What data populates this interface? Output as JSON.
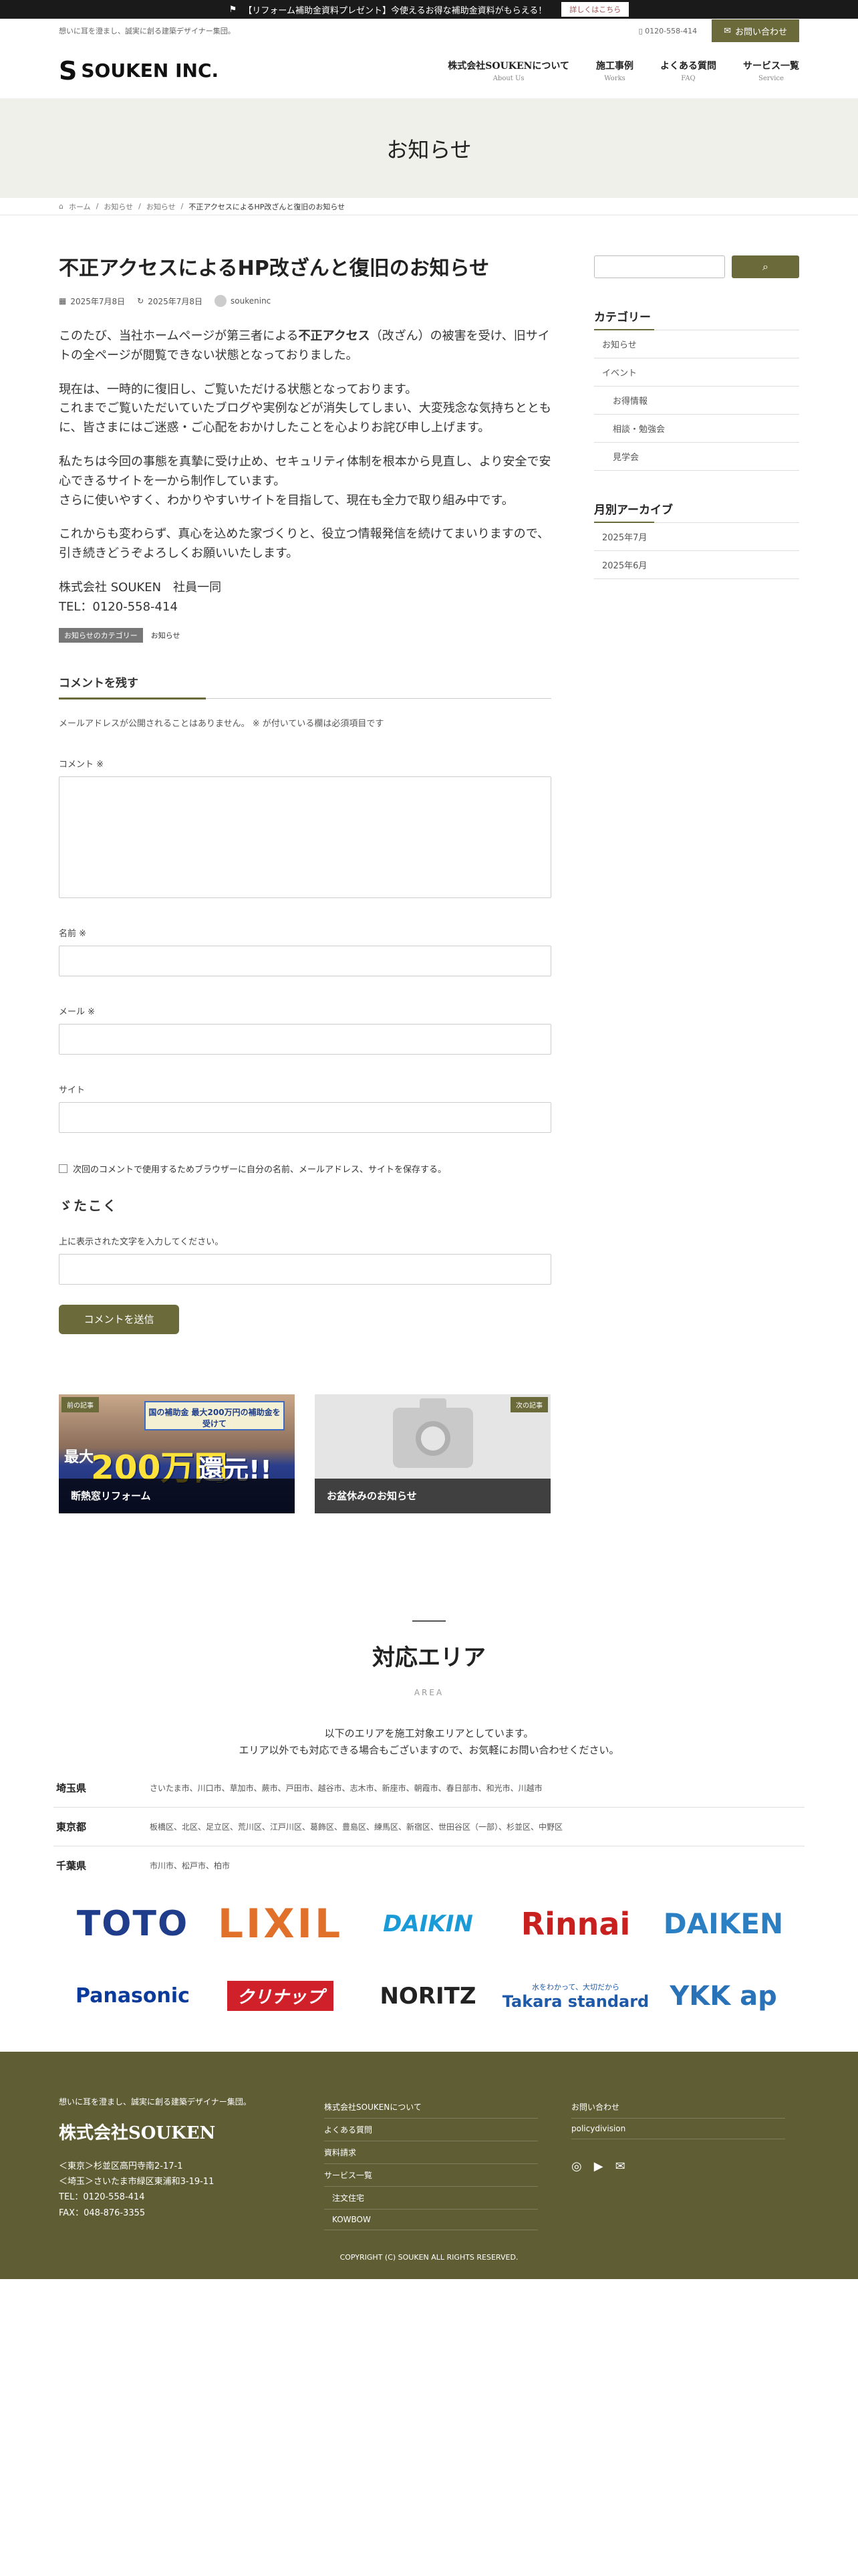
{
  "topbar": {
    "text": "【リフォーム補助金資料プレゼント】今使えるお得な補助金資料がもらえる！",
    "more": "詳しくはこちら"
  },
  "utility": {
    "tagline": "想いに耳を澄まし、誠実に創る建築デザイナー集団。",
    "phone": "0120-558-414",
    "contact": "お問い合わせ"
  },
  "header": {
    "logo": "SOUKEN INC.",
    "nav": [
      {
        "ja": "株式会社SOUKENについて",
        "en": "About Us"
      },
      {
        "ja": "施工事例",
        "en": "Works"
      },
      {
        "ja": "よくある質問",
        "en": "FAQ"
      },
      {
        "ja": "サービス一覧",
        "en": "Service"
      }
    ]
  },
  "hero": {
    "title": "お知らせ"
  },
  "breadcrumb": {
    "home": "ホーム",
    "c1": "お知らせ",
    "c2": "お知らせ",
    "current": "不正アクセスによるHP改ざんと復旧のお知らせ"
  },
  "post": {
    "title": "不正アクセスによるHP改ざんと復旧のお知らせ",
    "published": "2025年7月8日",
    "updated": "2025年7月8日",
    "author": "soukeninc",
    "p1a": "このたび、当社ホームページが第三者による",
    "p1b": "不正アクセス",
    "p1c": "（改ざん）の被害を受け、旧サイトの全ページが閲覧できない状態となっておりました。",
    "p2a": "現在は、一時的に復旧し、ご覧いただける状態となっております。",
    "p2b": "これまでご覧いただいていたブログや実例などが消失してしまい、大変残念な気持ちとともに、皆さまにはご迷惑・ご心配をおかけしたことを心よりお詫び申し上げます。",
    "p3a": "私たちは今回の事態を真摯に受け止め、セキュリティ体制を根本から見直し、より安全で安心できるサイトを一から制作しています。",
    "p3b": "さらに使いやすく、わかりやすいサイトを目指して、現在も全力で取り組み中です。",
    "p4": "これからも変わらず、真心を込めた家づくりと、役立つ情報発信を続けてまいりますので、引き続きどうぞよろしくお願いいたします。",
    "sign1": "株式会社 SOUKEN　社員一同",
    "sign2": "TEL：0120-558-414",
    "tag_label": "お知らせのカテゴリー",
    "tag": "お知らせ"
  },
  "comment": {
    "heading": "コメントを残す",
    "note": "メールアドレスが公開されることはありません。 ※ が付いている欄は必須項目です",
    "comment_label": "コメント ※",
    "name_label": "名前 ※",
    "email_label": "メール ※",
    "site_label": "サイト",
    "save_label": "次回のコメントで使用するためブラウザーに自分の名前、メールアドレス、サイトを保存する。",
    "captcha": "ゞたこく",
    "captcha_label": "上に表示された文字を入力してください。",
    "submit": "コメントを送信"
  },
  "related": [
    {
      "badge": "前の記事",
      "title": "断熱窓リフォーム",
      "banner": "国の補助金 最大200万円の補助金を受けて",
      "pre": "最大",
      "big": "200万円",
      "suf": "還元!!"
    },
    {
      "badge": "次の記事",
      "title": "お盆休みのお知らせ"
    }
  ],
  "sidebar": {
    "cat_title": "カテゴリー",
    "categories": [
      "お知らせ",
      "イベント",
      "お得情報",
      "相談・勉強会",
      "見学会"
    ],
    "arch_title": "月別アーカイブ",
    "archives": [
      "2025年7月",
      "2025年6月"
    ]
  },
  "area": {
    "title": "対応エリア",
    "en": "AREA",
    "desc1": "以下のエリアを施工対象エリアとしています。",
    "desc2": "エリア以外でも対応できる場合もございますので、お気軽にお問い合わせください。",
    "regions": [
      {
        "pref": "埼玉県",
        "cities": "さいたま市、川口市、草加市、蕨市、戸田市、越谷市、志木市、新座市、朝霞市、春日部市、和光市、川越市"
      },
      {
        "pref": "東京都",
        "cities": "板橋区、北区、足立区、荒川区、江戸川区、葛飾区、豊島区、練馬区、新宿区、世田谷区（一部）、杉並区、中野区"
      },
      {
        "pref": "千葉県",
        "cities": "市川市、松戸市、柏市"
      }
    ]
  },
  "logos": [
    {
      "text": "TOTO",
      "color": "#1f3d8a"
    },
    {
      "text": "LIXIL",
      "color": "#e0702a"
    },
    {
      "text": "DAIKIN",
      "color": "#1a9ad6"
    },
    {
      "text": "Rinnai",
      "color": "#c8201e"
    },
    {
      "text": "DAIKEN",
      "color": "#2b7fc3"
    },
    {
      "text": "Panasonic",
      "color": "#0a3a9a"
    },
    {
      "text": "クリナップ",
      "color": "#d0202a"
    },
    {
      "text": "NORITZ",
      "color": "#222222"
    },
    {
      "text": "Takara standard",
      "color": "#1f5aa8",
      "sub": "水をわかって、大切だから"
    },
    {
      "text": "YKK ap",
      "color": "#2a72b8"
    }
  ],
  "footer": {
    "tagline": "想いに耳を澄まし、誠実に創る建築デザイナー集団。",
    "name": "株式会社SOUKEN",
    "addr1": "＜東京＞杉並区高円寺南2-17-1",
    "addr2": "＜埼玉＞さいたま市緑区東浦和3-19-11",
    "tel": "TEL：0120-558-414",
    "fax": "FAX：048-876-3355",
    "links": [
      "株式会社SOUKENについて",
      "よくある質問",
      "資料請求",
      "サービス一覧",
      "注文住宅",
      "KOWBOW"
    ],
    "links2": [
      "お問い合わせ",
      "policydivision"
    ],
    "copyright": "COPYRIGHT (C) SOUKEN ALL RIGHTS RESERVED."
  }
}
